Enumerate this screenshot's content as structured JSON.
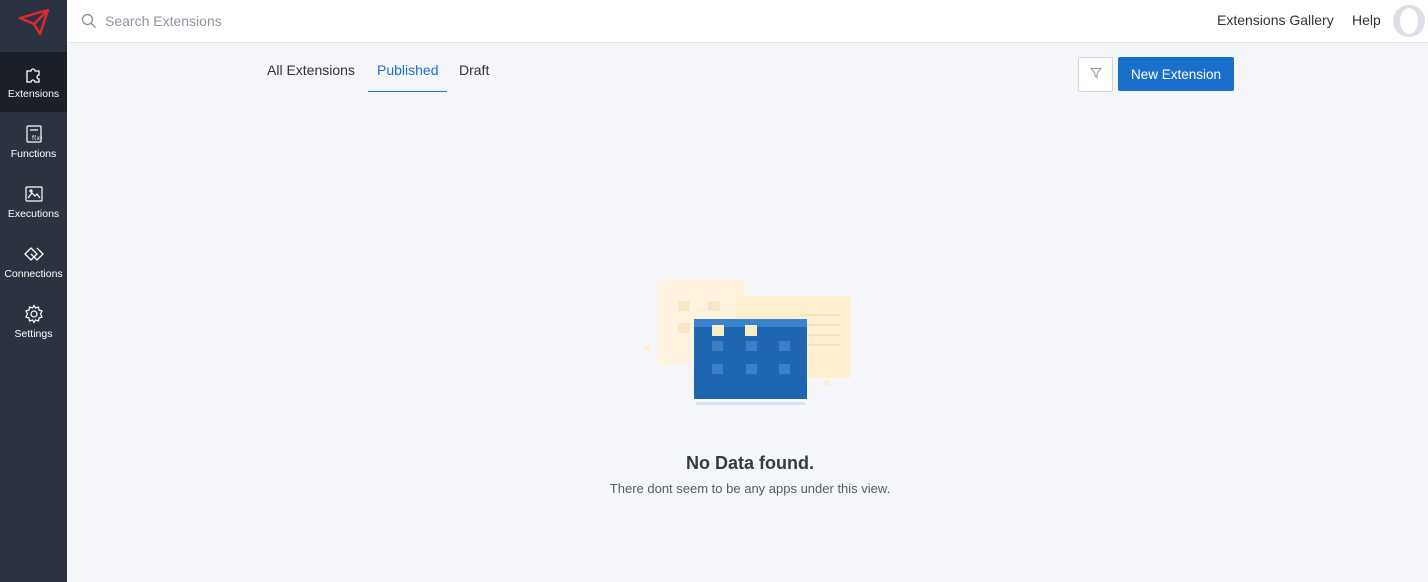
{
  "sidebar": {
    "logo": "paper-plane-logo",
    "items": [
      {
        "label": "Extensions",
        "icon": "puzzle-icon",
        "active": true
      },
      {
        "label": "Functions",
        "icon": "function-icon",
        "active": false
      },
      {
        "label": "Executions",
        "icon": "image-icon",
        "active": false
      },
      {
        "label": "Connections",
        "icon": "connections-icon",
        "active": false
      },
      {
        "label": "Settings",
        "icon": "gear-icon",
        "active": false
      }
    ]
  },
  "topbar": {
    "search_placeholder": "Search Extensions",
    "gallery_label": "Extensions Gallery",
    "help_label": "Help"
  },
  "tabs": [
    {
      "label": "All Extensions"
    },
    {
      "label": "Published",
      "active": true
    },
    {
      "label": "Draft"
    }
  ],
  "actions": {
    "new_label": "New Extension"
  },
  "empty_state": {
    "title": "No Data found.",
    "subtitle": "There dont seem to be any apps under this view."
  },
  "colors": {
    "accent": "#1a6fcb",
    "sidebar": "#2b3340",
    "sidebar_active": "#1a1f28",
    "logo": "#e0282e"
  }
}
